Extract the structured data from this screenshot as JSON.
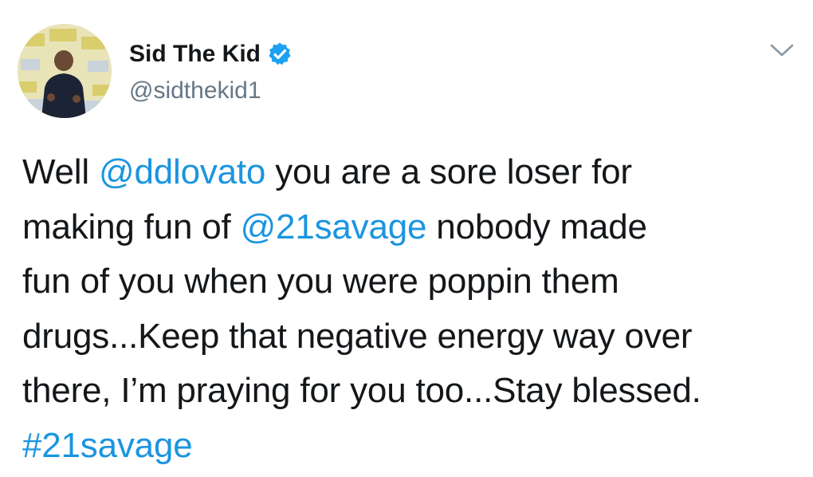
{
  "author": {
    "display_name": "Sid The Kid",
    "handle": "@sidthekid1",
    "verified": true,
    "avatar_icon": "profile-photo"
  },
  "menu": {
    "icon": "chevron-down-icon"
  },
  "tweet": {
    "segments": [
      {
        "text": "Well ",
        "type": "text"
      },
      {
        "text": "@ddlovato",
        "type": "mention"
      },
      {
        "text": " you are a sore loser for\nmaking fun of ",
        "type": "text"
      },
      {
        "text": "@21savage",
        "type": "mention"
      },
      {
        "text": " nobody made\nfun of you when you were poppin them\ndrugs...Keep that negative energy way over\nthere, I’m praying for you too...Stay blessed.\n",
        "type": "text"
      },
      {
        "text": "#21savage",
        "type": "hashtag"
      }
    ]
  },
  "colors": {
    "link": "#1b95e0",
    "text": "#14171a",
    "secondary": "#657786",
    "verified_badge": "#1da1f2"
  }
}
